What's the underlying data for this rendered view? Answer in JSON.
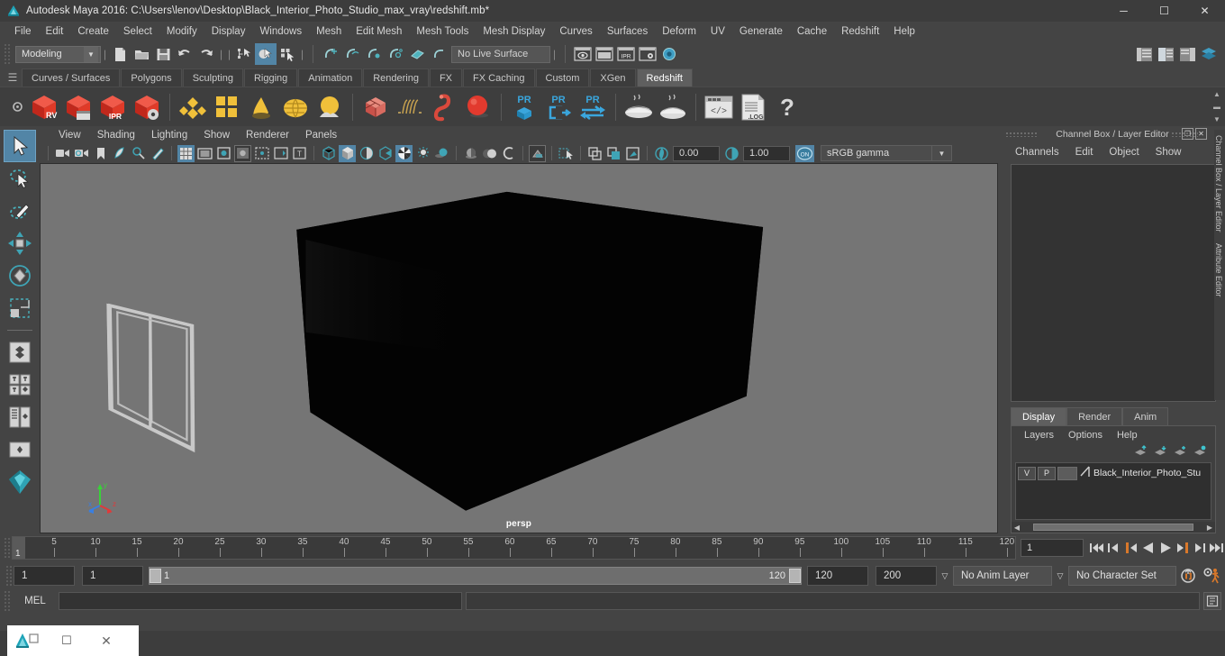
{
  "window": {
    "title": "Autodesk Maya 2016: C:\\Users\\lenov\\Desktop\\Black_Interior_Photo_Studio_max_vray\\redshift.mb*",
    "minimize": "─",
    "maximize": "☐",
    "close": "✕"
  },
  "menubar": {
    "items": [
      "File",
      "Edit",
      "Create",
      "Select",
      "Modify",
      "Display",
      "Windows",
      "Mesh",
      "Edit Mesh",
      "Mesh Tools",
      "Mesh Display",
      "Curves",
      "Surfaces",
      "Deform",
      "UV",
      "Generate",
      "Cache",
      "Redshift",
      "Help"
    ]
  },
  "statusline": {
    "menu_set": "Modeling",
    "live_surface": "No Live Surface",
    "icons": [
      "new-scene-icon",
      "open-scene-icon",
      "save-scene-icon",
      "undo-icon",
      "redo-icon",
      "select-by-hierarchy-icon",
      "select-by-object-icon",
      "select-by-component-icon",
      "snap-to-grid-icon",
      "snap-to-curve-icon",
      "snap-to-point-icon",
      "snap-to-projected-center-icon",
      "snap-to-view-plane-icon",
      "make-live-icon",
      "render-view-icon",
      "render-sequence-icon",
      "ipr-render-icon",
      "render-settings-icon",
      "hypershade-icon"
    ]
  },
  "shelf": {
    "tabs": [
      "Curves / Surfaces",
      "Polygons",
      "Sculpting",
      "Rigging",
      "Animation",
      "Rendering",
      "FX",
      "FX Caching",
      "Custom",
      "XGen",
      "Redshift"
    ],
    "active_tab": "Redshift",
    "buttons": [
      {
        "name": "redshift-render-view",
        "label": "RV"
      },
      {
        "name": "redshift-render-sequence",
        "label": ""
      },
      {
        "name": "redshift-ipr",
        "label": "IPR"
      },
      {
        "name": "redshift-render-settings",
        "label": ""
      },
      {
        "name": "redshift-material",
        "label": ""
      },
      {
        "name": "redshift-material-blender",
        "label": ""
      },
      {
        "name": "redshift-sss-material",
        "label": ""
      },
      {
        "name": "redshift-environment",
        "label": ""
      },
      {
        "name": "redshift-sun-sky",
        "label": ""
      },
      {
        "name": "redshift-proxy",
        "label": ""
      },
      {
        "name": "redshift-hair",
        "label": ""
      },
      {
        "name": "redshift-volume",
        "label": ""
      },
      {
        "name": "redshift-sphere-light",
        "label": ""
      },
      {
        "name": "redshift-pr-object",
        "label": "PR"
      },
      {
        "name": "redshift-pr-export",
        "label": "PR"
      },
      {
        "name": "redshift-pr-transfer",
        "label": "PR"
      },
      {
        "name": "redshift-bake-set",
        "label": ""
      },
      {
        "name": "redshift-bake-render",
        "label": ""
      },
      {
        "name": "redshift-script-editor",
        "label": ""
      },
      {
        "name": "redshift-log",
        "label": ".LOG"
      },
      {
        "name": "redshift-help",
        "label": "?"
      }
    ]
  },
  "toolbox": {
    "items": [
      "select-tool",
      "lasso-select-tool",
      "paint-select-tool",
      "move-tool",
      "rotate-tool",
      "scale-tool",
      "last-tool",
      "single-perspective-layout",
      "four-view-layout",
      "outliner-persp-layout",
      "persp-graph-layout",
      "hypershade-layout"
    ]
  },
  "viewport": {
    "menus": [
      "View",
      "Shading",
      "Lighting",
      "Show",
      "Renderer",
      "Panels"
    ],
    "camera_label": "persp",
    "exposure": "0.00",
    "gamma": "1.00",
    "color_mode": "sRGB gamma",
    "toggle_label": "ON",
    "toolbar_icons": [
      "select-camera-icon",
      "camera-attributes-icon",
      "bookmark-icon",
      "image-plane-icon",
      "two-d-pan-zoom-icon",
      "grease-pencil-icon",
      "grid-toggle-icon",
      "film-gate-icon",
      "resolution-gate-icon",
      "gate-mask-icon",
      "film-origin-icon",
      "safe-action-icon",
      "title-safe-icon",
      "wireframe-icon",
      "smooth-shade-icon",
      "shaded-wireframe-icon",
      "flat-shade-icon",
      "textured-icon",
      "use-lights-icon",
      "shadows-icon",
      "ao-icon",
      "motion-blur-icon",
      "isolate-select-icon",
      "xray-icon",
      "xray-joints-icon",
      "xray-active-icon",
      "exposure-icon",
      "gamma-icon",
      "color-management-icon"
    ]
  },
  "channelbox": {
    "panel_title": "Channel Box / Layer Editor",
    "undock": "❐",
    "close": "✕",
    "menus": [
      "Channels",
      "Edit",
      "Object",
      "Show"
    ],
    "side_tabs": [
      "Channel Box / Layer Editor",
      "Attribute Editor"
    ]
  },
  "layer_editor": {
    "tabs": [
      "Display",
      "Render",
      "Anim"
    ],
    "active_tab": "Display",
    "menus": [
      "Layers",
      "Options",
      "Help"
    ],
    "toolbar_icons": [
      "move-layer-up-icon",
      "move-layer-down-icon",
      "new-layer-icon",
      "new-layer-from-selected-icon"
    ],
    "rows": [
      {
        "visibility": "V",
        "playback": "P",
        "color": "",
        "name": "Black_Interior_Photo_Stu"
      }
    ]
  },
  "timeline": {
    "ticks": [
      5,
      10,
      15,
      20,
      25,
      30,
      35,
      40,
      45,
      50,
      55,
      60,
      65,
      70,
      75,
      80,
      85,
      90,
      95,
      100,
      105,
      110,
      115,
      120
    ],
    "current_frame": "1",
    "current_frame_field": "1",
    "playback_buttons": [
      "go-to-start-icon",
      "step-back-key-icon",
      "step-back-frame-icon",
      "play-backwards-icon",
      "play-forwards-icon",
      "step-forward-frame-icon",
      "step-forward-key-icon",
      "go-to-end-icon"
    ]
  },
  "range": {
    "anim_start": "1",
    "range_start": "1",
    "slider_left_value": "1",
    "slider_right_value": "120",
    "range_end": "120",
    "anim_end": "200",
    "anim_layer": "No Anim Layer",
    "character_set": "No Character Set",
    "auto_key_icon": "auto-keyframe-icon",
    "anim_prefs_icon": "animation-preferences-icon"
  },
  "command_line": {
    "language": "MEL",
    "input_value": "",
    "output_value": "",
    "script_editor_icon": "script-editor-icon"
  },
  "taskbar": {
    "app_icon": "maya-app-icon",
    "restore": "❐",
    "minimize": "☐",
    "close": "✕"
  },
  "colors": {
    "accent": "#5285a6",
    "panel_bg": "#444444",
    "dark_bg": "#2f2f2f",
    "viewport_bg": "#757575",
    "redshift_red": "#d93a2b",
    "shelf_gold": "#e8b73a",
    "orange": "#d77a28"
  }
}
